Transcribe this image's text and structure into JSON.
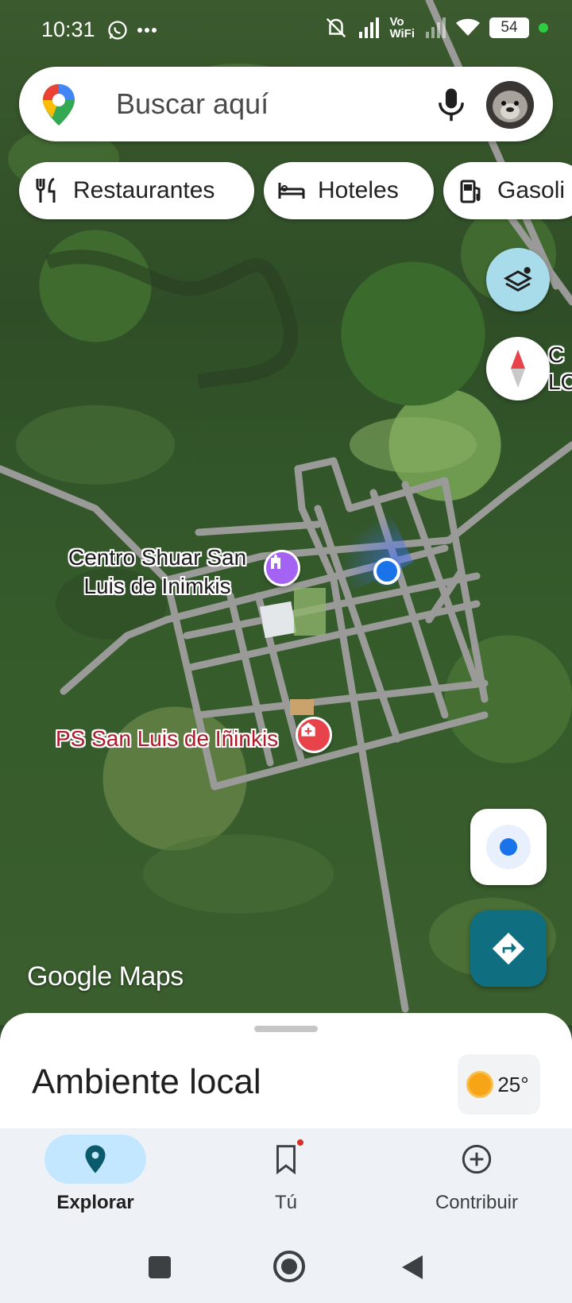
{
  "status_bar": {
    "time": "10:31",
    "left_icons": [
      "whatsapp-icon",
      "more-dots-icon"
    ],
    "right_icons": [
      "mute-vibrate-icon",
      "signal-icon",
      "vowifi-icon",
      "wifi-icon"
    ],
    "vowifi_text": "Vo\nWiFi",
    "battery_level": "54"
  },
  "search": {
    "placeholder": "Buscar aquí"
  },
  "chips": [
    {
      "label": "Restaurantes",
      "icon": "fork-knife-icon"
    },
    {
      "label": "Hoteles",
      "icon": "bed-icon"
    },
    {
      "label": "Gasoli",
      "icon": "gas-station-icon"
    }
  ],
  "map": {
    "places": [
      {
        "name": "Centro Shuar San\nLuis de Inimkis",
        "icon": "cultural-center-icon",
        "color": "#a463f2"
      },
      {
        "name": "PS San Luis de Iñinkis",
        "icon": "hospital-icon",
        "color": "#e8434b"
      }
    ],
    "edge_label": "C\nLOS",
    "watermark_google": "Google",
    "watermark_maps": "Maps"
  },
  "bottom_sheet": {
    "title": "Ambiente local",
    "temperature": "25°"
  },
  "nav": {
    "items": [
      {
        "label": "Explorar",
        "icon": "explore-pin-icon",
        "active": true
      },
      {
        "label": "Tú",
        "icon": "bookmark-icon",
        "active": false,
        "badge": true
      },
      {
        "label": "Contribuir",
        "icon": "add-circle-icon",
        "active": false
      }
    ]
  },
  "colors": {
    "accent_blue": "#1a73e8",
    "directions_teal": "#0f6e80",
    "layers_button": "#a8dcea",
    "active_pill": "#c2e7ff"
  }
}
